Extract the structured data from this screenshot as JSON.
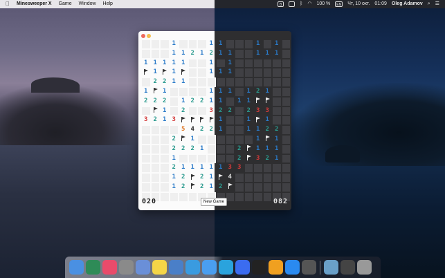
{
  "menubar": {
    "apple": "",
    "app_name": "Minesweeper X",
    "menus": [
      "Game",
      "Window",
      "Help"
    ],
    "status": {
      "battery_percent": "100 %",
      "input_source": "EN",
      "datetime": "Чт, 10 окт.",
      "time": "01:09",
      "user": "Oleg Adamov"
    }
  },
  "game": {
    "left_counter": "020",
    "right_counter": "082",
    "new_game_label": "New Game",
    "rows": [
      [
        "#",
        "#",
        "#",
        "1",
        "#",
        "#",
        "#",
        "1",
        "1",
        "#",
        "#",
        "#",
        "1",
        "#",
        "1",
        "#"
      ],
      [
        "#",
        "#",
        "#",
        "1",
        "1",
        "2",
        "1",
        "2",
        "1",
        "1",
        "#",
        "#",
        "1",
        "1",
        "1",
        "#"
      ],
      [
        "1",
        "1",
        "1",
        "1",
        "1",
        "#",
        "#",
        "1",
        "#",
        "1",
        "#",
        "#",
        "#",
        "#",
        "#",
        "#"
      ],
      [
        "F",
        "1",
        "F",
        "1",
        "F",
        "#",
        "#",
        "1",
        "1",
        "1",
        "#",
        "#",
        "#",
        "#",
        "#",
        "#"
      ],
      [
        "#",
        "2",
        "2",
        "1",
        "1",
        "#",
        "#",
        "#",
        "#",
        "#",
        "#",
        "#",
        "#",
        "#",
        "#",
        "#"
      ],
      [
        "1",
        "F",
        "1",
        "#",
        "#",
        "#",
        "#",
        "1",
        "1",
        "1",
        "#",
        "1",
        "2",
        "1",
        "#",
        "#"
      ],
      [
        "2",
        "2",
        "2",
        "#",
        "1",
        "2",
        "2",
        "1",
        "1",
        "#",
        "1",
        "1",
        "F",
        "F",
        "#",
        "#"
      ],
      [
        "#",
        "F",
        "1",
        "#",
        "2",
        "#",
        "#",
        "3",
        "2",
        "2",
        "#",
        "2",
        "3",
        "3",
        "#",
        "#"
      ],
      [
        "3",
        "2",
        "1",
        "3",
        "F",
        "F",
        "F",
        "F",
        "1",
        "#",
        "#",
        "1",
        "F",
        "1",
        "#",
        "#"
      ],
      [
        "#",
        "#",
        "#",
        "#",
        "5",
        "4",
        "2",
        "2",
        "1",
        "#",
        "#",
        "1",
        "1",
        "2",
        "2",
        "#"
      ],
      [
        "#",
        "#",
        "#",
        "2",
        "F",
        "1",
        "#",
        "#",
        "#",
        "#",
        "#",
        "#",
        "1",
        "F",
        "1",
        "#"
      ],
      [
        "#",
        "#",
        "#",
        "2",
        "2",
        "2",
        "1",
        "#",
        "#",
        "#",
        "2",
        "F",
        "1",
        "1",
        "1",
        "#"
      ],
      [
        "#",
        "#",
        "#",
        "1",
        "#",
        "#",
        "#",
        "#",
        "#",
        "#",
        "2",
        "F",
        "3",
        "2",
        "1",
        "#"
      ],
      [
        "#",
        "#",
        "#",
        "2",
        "1",
        "1",
        "1",
        "1",
        "1",
        "3",
        "3",
        "#",
        "#",
        "#",
        "#",
        "#"
      ],
      [
        "#",
        "#",
        "#",
        "1",
        "2",
        "F",
        "2",
        "1",
        "F",
        "4",
        "#",
        "#",
        "#",
        "#",
        "#",
        "#"
      ],
      [
        "#",
        "#",
        "#",
        "1",
        "2",
        "F",
        "2",
        "1",
        "2",
        "F",
        "#",
        "#",
        "#",
        "#",
        "#",
        "#"
      ],
      [
        "#",
        "#",
        "#",
        "#",
        "#",
        "#",
        "#",
        "#",
        "#",
        "#",
        "#",
        "#",
        "#",
        "#",
        "#",
        "#"
      ]
    ]
  },
  "dock": {
    "apps": [
      "finder-icon",
      "safari-compass-icon",
      "music-icon",
      "system-prefs-icon",
      "preview-icon",
      "notes-icon",
      "xcode-icon",
      "safari-icon",
      "messages-icon",
      "telegram-icon",
      "messenger-icon",
      "terminal-icon",
      "sublime-icon",
      "app-store-icon",
      "minesweeper-icon",
      "folder-icon",
      "screenshot-icon",
      "trash-icon"
    ]
  }
}
